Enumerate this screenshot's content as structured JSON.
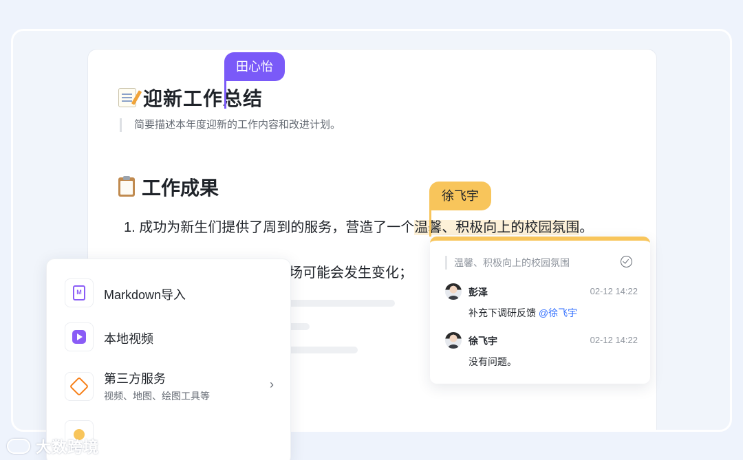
{
  "document": {
    "title": "迎新工作总结",
    "title_emoji": "memo",
    "description": "简要描述本年度迎新的工作内容和改进计划。",
    "section_heading": "工作成果",
    "section_emoji": "clipboard",
    "list_item_1_prefix": "1. 成功为新生们提供了周到的服务，营造了一个",
    "list_item_1_highlight": "温馨、积极向上的校园氛围",
    "list_item_1_suffix": "。",
    "list_item_2_visible": "场可能会发生变化；"
  },
  "collaborators": {
    "cursor_1_name": "田心怡",
    "cursor_1_color": "#7a5af8",
    "cursor_2_name": "徐飞宇",
    "cursor_2_color": "#f8c55b"
  },
  "comment_panel": {
    "quoted_text": "温馨、积极向上的校园氛围",
    "resolve_icon": "check-circle-icon",
    "comments": [
      {
        "author": "彭泽",
        "time": "02-12 14:22",
        "text": "补充下调研反馈 ",
        "mention": "@徐飞宇"
      },
      {
        "author": "徐飞宇",
        "time": "02-12 14:22",
        "text": "没有问题。",
        "mention": ""
      }
    ]
  },
  "insert_menu": {
    "items": [
      {
        "label": "Markdown导入",
        "icon": "markdown-icon"
      },
      {
        "label": "本地视频",
        "icon": "video-icon"
      },
      {
        "label": "第三方服务",
        "sublabel": "视频、地图、绘图工具等",
        "icon": "box-icon",
        "has_submenu": true
      }
    ],
    "arrow_glyph": "›"
  },
  "watermark": {
    "text": "大数跨境"
  }
}
